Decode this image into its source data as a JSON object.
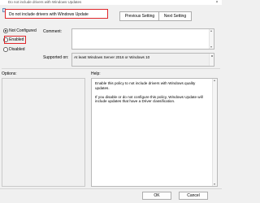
{
  "window": {
    "title": "Do not include drivers with Windows Updates",
    "close_glyph": "×"
  },
  "policy": {
    "name": "Do not include drivers with Windows Update"
  },
  "nav": {
    "previous_label": "Previous Setting",
    "next_label": "Next Setting"
  },
  "state": {
    "options": [
      {
        "label": "Not Configured",
        "selected": true
      },
      {
        "label": "Enabled",
        "selected": false
      },
      {
        "label": "Disabled",
        "selected": false
      }
    ]
  },
  "comment": {
    "label": "Comment:",
    "value": ""
  },
  "supported": {
    "label": "Supported on:",
    "value": "At least Windows Server 2016 or Windows 10"
  },
  "panes": {
    "options_label": "Options:",
    "help_label": "Help:"
  },
  "help": {
    "paragraphs": [
      "Enable this policy to not include drivers with Windows quality updates.",
      "If you disable or do not configure this policy, Windows Update will include updates that have a Driver classification."
    ]
  },
  "footer": {
    "ok_label": "OK",
    "cancel_label": "Cancel"
  },
  "colors": {
    "highlight_red": "#e0262b",
    "window_bg": "#f0f0f0"
  }
}
